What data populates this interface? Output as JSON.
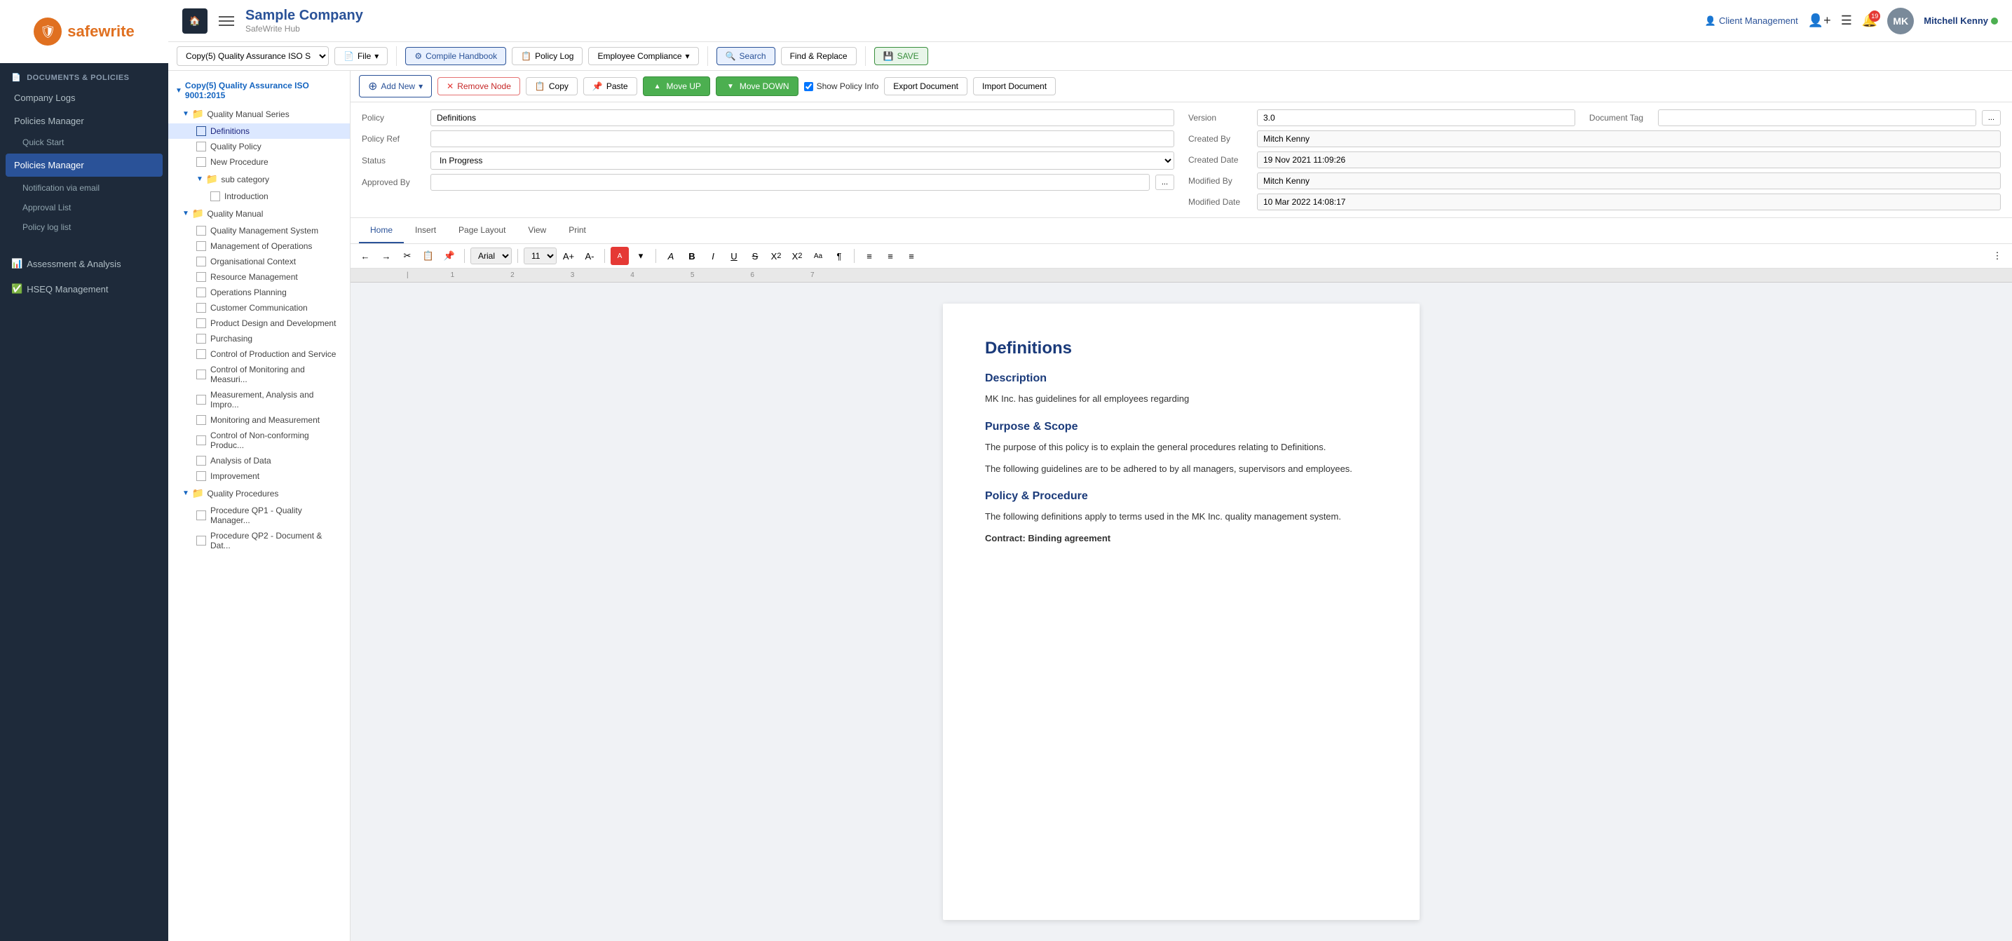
{
  "app": {
    "company": "Sample Company",
    "subtitle": "SafeWrite Hub",
    "home_icon": "🏠"
  },
  "topbar": {
    "client_management": "Client Management",
    "user_name": "Mitchell Kenny",
    "notification_count": "19"
  },
  "toolbar": {
    "dropdown_label": "Copy(5) Quality Assurance ISO S",
    "file_label": "File",
    "compile_label": "Compile Handbook",
    "policy_log_label": "Policy Log",
    "employee_compliance_label": "Employee Compliance",
    "search_label": "Search",
    "find_replace_label": "Find & Replace",
    "save_label": "SAVE"
  },
  "action_bar": {
    "add_new": "Add New",
    "remove_node": "Remove Node",
    "copy": "Copy",
    "paste": "Paste",
    "move_up": "Move UP",
    "move_down": "Move DOWN",
    "show_policy_info": "Show Policy Info",
    "export_document": "Export Document",
    "import_document": "Import Document"
  },
  "policy_meta": {
    "policy_label": "Policy",
    "policy_value": "Definitions",
    "policy_ref_label": "Policy Ref",
    "policy_ref_value": "",
    "status_label": "Status",
    "status_value": "In Progress",
    "approved_by_label": "Approved By",
    "approved_by_value": "",
    "version_label": "Version",
    "version_value": "3.0",
    "document_tag_label": "Document Tag",
    "document_tag_value": "",
    "created_by_label": "Created By",
    "created_by_value": "Mitch Kenny",
    "created_date_label": "Created Date",
    "created_date_value": "19 Nov 2021 11:09:26",
    "modified_by_label": "Modified By",
    "modified_by_value": "Mitch Kenny",
    "modified_date_label": "Modified Date",
    "modified_date_value": "10 Mar 2022 14:08:17"
  },
  "editor_tabs": [
    "Home",
    "Insert",
    "Page Layout",
    "View",
    "Print"
  ],
  "format_bar": {
    "font": "Arial",
    "size": "11"
  },
  "document": {
    "title": "Definitions",
    "section1_heading": "Description",
    "section1_text": "MK Inc. has guidelines for all employees regarding",
    "section2_heading": "Purpose & Scope",
    "section2_text1": "The purpose of this policy is to explain the general procedures relating to Definitions.",
    "section2_text2": "The following guidelines are to be adhered to by all managers, supervisors and employees.",
    "section3_heading": "Policy & Procedure",
    "section3_text": "The following definitions apply to terms used in the  MK Inc. quality management system.",
    "section3_term": "Contract: Binding agreement"
  },
  "sidebar": {
    "section_label": "DOCUMENTS & POLICIES",
    "items": [
      {
        "id": "company-logs",
        "label": "Company Logs",
        "indent": 0
      },
      {
        "id": "policies-manager-main",
        "label": "Policies Manager",
        "indent": 0
      },
      {
        "id": "quick-start",
        "label": "Quick Start",
        "indent": 1
      },
      {
        "id": "policies-manager-sub",
        "label": "Policies Manager",
        "indent": 1,
        "active": true
      },
      {
        "id": "notification-email",
        "label": "Notification via email",
        "indent": 1
      },
      {
        "id": "approval-list",
        "label": "Approval List",
        "indent": 1
      },
      {
        "id": "policy-log-list",
        "label": "Policy log list",
        "indent": 1
      }
    ],
    "bottom_items": [
      {
        "id": "assessment-analysis",
        "label": "Assessment & Analysis",
        "indent": 0
      },
      {
        "id": "hseq-management",
        "label": "HSEQ Management",
        "indent": 0
      }
    ]
  },
  "tree": {
    "root": "Copy(5) Quality Assurance ISO 9001:2015",
    "nodes": [
      {
        "type": "folder",
        "label": "Quality Manual Series",
        "indent": 1
      },
      {
        "type": "item",
        "label": "Definitions",
        "indent": 2,
        "selected": true
      },
      {
        "type": "item",
        "label": "Quality Policy",
        "indent": 2
      },
      {
        "type": "item",
        "label": "New Procedure",
        "indent": 2
      },
      {
        "type": "folder",
        "label": "sub category",
        "indent": 2
      },
      {
        "type": "item",
        "label": "Introduction",
        "indent": 3
      },
      {
        "type": "folder",
        "label": "Quality Manual",
        "indent": 1
      },
      {
        "type": "item",
        "label": "Quality Management System",
        "indent": 2
      },
      {
        "type": "item",
        "label": "Management of Operations",
        "indent": 2
      },
      {
        "type": "item",
        "label": "Organisational Context",
        "indent": 2
      },
      {
        "type": "item",
        "label": "Resource Management",
        "indent": 2
      },
      {
        "type": "item",
        "label": "Operations Planning",
        "indent": 2
      },
      {
        "type": "item",
        "label": "Customer Communication",
        "indent": 2
      },
      {
        "type": "item",
        "label": "Product Design and Development",
        "indent": 2
      },
      {
        "type": "item",
        "label": "Purchasing",
        "indent": 2
      },
      {
        "type": "item",
        "label": "Control of Production and Service",
        "indent": 2
      },
      {
        "type": "item",
        "label": "Control of Monitoring and Measuri...",
        "indent": 2
      },
      {
        "type": "item",
        "label": "Measurement, Analysis and Impro...",
        "indent": 2
      },
      {
        "type": "item",
        "label": "Monitoring and Measurement",
        "indent": 2
      },
      {
        "type": "item",
        "label": "Control of Non-conforming Produc...",
        "indent": 2
      },
      {
        "type": "item",
        "label": "Analysis of Data",
        "indent": 2
      },
      {
        "type": "item",
        "label": "Improvement",
        "indent": 2
      },
      {
        "type": "folder",
        "label": "Quality Procedures",
        "indent": 1
      },
      {
        "type": "item",
        "label": "Procedure QP1 - Quality Manager...",
        "indent": 2
      },
      {
        "type": "item",
        "label": "Procedure QP2 - Document & Dat...",
        "indent": 2
      }
    ]
  }
}
